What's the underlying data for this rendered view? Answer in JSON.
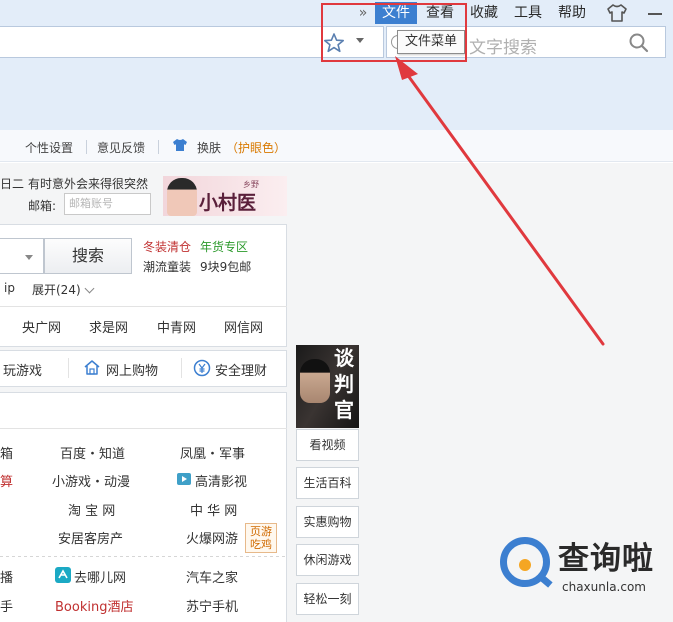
{
  "menubar": {
    "more": "»",
    "items": [
      "文件",
      "查看",
      "收藏",
      "工具",
      "帮助"
    ],
    "active_index": 0
  },
  "search": {
    "placeholder": "文字搜索"
  },
  "tooltip": "文件菜单",
  "toolbar": {
    "items": [
      "个性设置",
      "意见反馈",
      "换肤",
      "（护眼色）"
    ]
  },
  "info": {
    "date_fragment": "日二",
    "news": "有时意外会来得很突然",
    "email_label": "邮箱:",
    "email_placeholder": "邮箱账号",
    "banner_sub": "乡野",
    "banner_title": "小村医"
  },
  "searchbox": {
    "button": "搜索",
    "promo": [
      {
        "text": "冬装清仓",
        "color": "#c03030"
      },
      {
        "text": "年货专区",
        "color": "#2c9a2c"
      },
      {
        "text": "潮流童装",
        "color": "#333333"
      },
      {
        "text": "9块9包邮",
        "color": "#333333"
      }
    ],
    "ip": "ip",
    "expand": "展开(24)"
  },
  "sites": [
    "央广网",
    "求是网",
    "中青网",
    "网信网"
  ],
  "categories": [
    "玩游戏",
    "网上购物",
    "安全理财"
  ],
  "links": [
    [
      "箱",
      "百度・知道",
      "凤凰・军事"
    ],
    [
      "算",
      "小游戏・动漫",
      "高清影视"
    ],
    [
      "",
      "淘 宝 网",
      "中 华 网"
    ],
    [
      "",
      "安居客房产",
      "火爆网游"
    ],
    [
      "播",
      "去哪儿网",
      "汽车之家"
    ],
    [
      "手",
      "Booking酒店",
      "苏宁手机"
    ]
  ],
  "tag": "页游吃鸡",
  "poster": [
    "谈",
    "判",
    "官"
  ],
  "side_buttons": [
    "看视频",
    "生活百科",
    "实惠购物",
    "休闲游戏",
    "轻松一刻"
  ],
  "watermark": {
    "main": "查询啦",
    "sub": "chaxunla.com"
  },
  "colors": {
    "accent": "#3c7fd0",
    "annotation_red": "#e0393e",
    "chrome_bg": "#e3edf9"
  }
}
